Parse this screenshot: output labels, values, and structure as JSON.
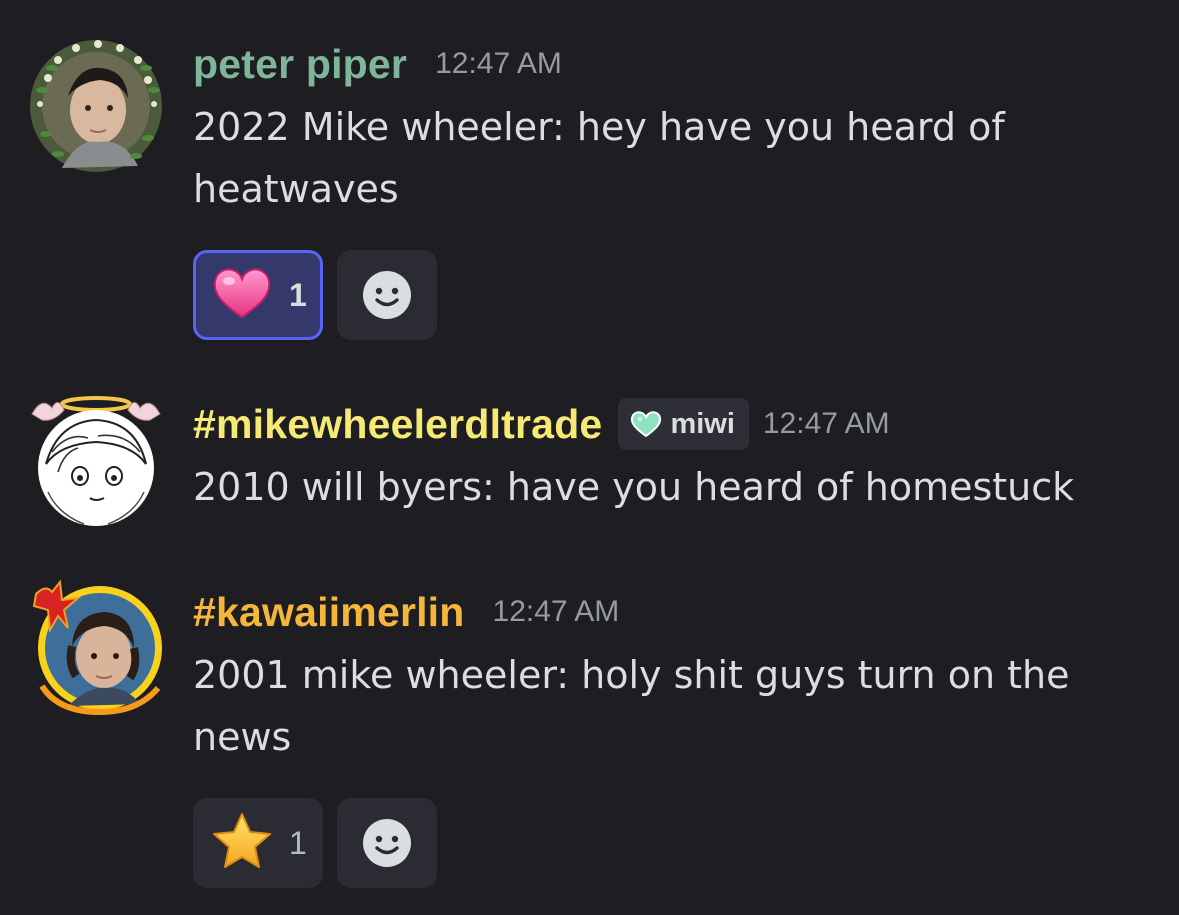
{
  "colors": {
    "background": "#1d1d22",
    "accent": "#5865f2",
    "timestamp": "#949ba4"
  },
  "messages": [
    {
      "author": "peter piper",
      "author_color": "#7fb69a",
      "timestamp": "12:47 AM",
      "text": "2022 Mike wheeler: hey have you heard of heatwaves",
      "avatar_icon": "portrait-with-floral-wreath",
      "reactions": [
        {
          "emoji": "sparkling-heart",
          "glyph": "💗",
          "count": "1",
          "active": true
        }
      ]
    },
    {
      "author": "#mikewheelerdltrade",
      "author_color": "#f7ea74",
      "timestamp": "12:47 AM",
      "tag": {
        "icon": "green-heart-icon",
        "label": "miwi"
      },
      "text": "2010 will byers: have you heard of homestuck",
      "avatar_icon": "sketch-portrait-with-halo",
      "reactions": []
    },
    {
      "author": "#kawaiimerlin",
      "author_color": "#f5b73b",
      "timestamp": "12:47 AM",
      "text": "2001 mike wheeler: holy shit guys turn on the news",
      "avatar_icon": "portrait-with-flame-frame",
      "reactions": [
        {
          "emoji": "star",
          "glyph": "⭐",
          "count": "1",
          "active": false
        }
      ]
    }
  ]
}
